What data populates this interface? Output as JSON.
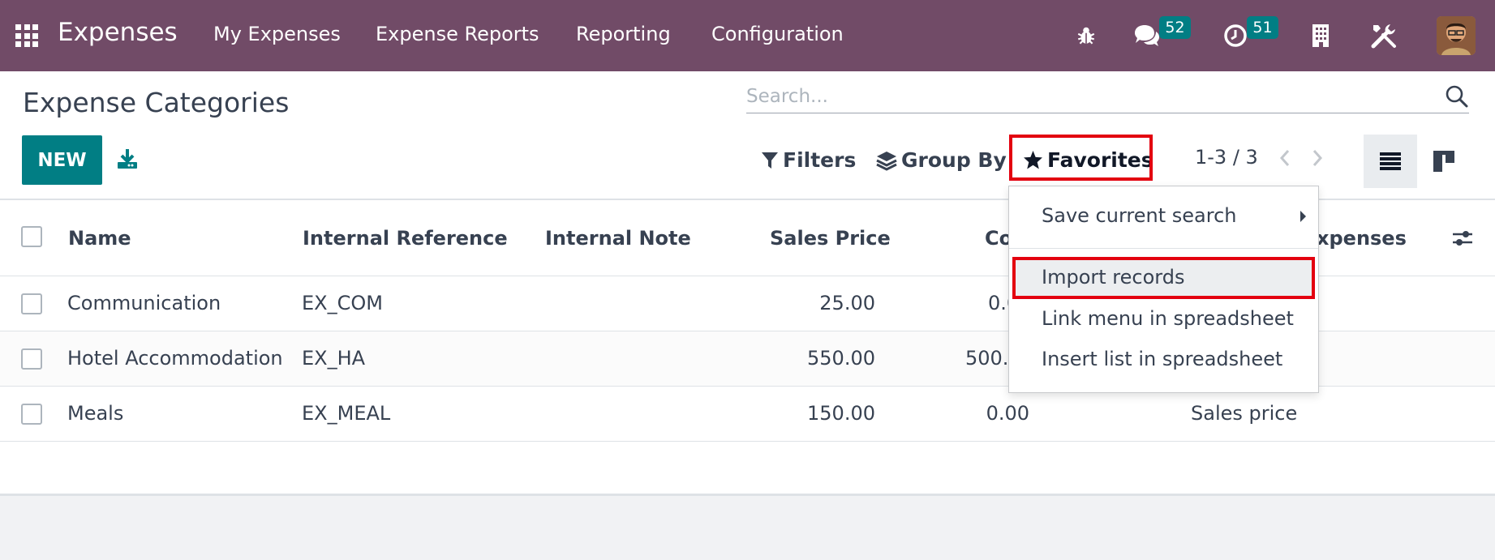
{
  "navbar": {
    "app_title": "Expenses",
    "menu": [
      "My Expenses",
      "Expense Reports",
      "Reporting",
      "Configuration"
    ],
    "messages_count": "52",
    "activities_count": "51",
    "bg_color": "#714b67",
    "badge_color": "#017e84"
  },
  "panel": {
    "title": "Expense Categories",
    "search_placeholder": "Search...",
    "new_label": "NEW",
    "filters_label": "Filters",
    "groupby_label": "Group By",
    "favorites_label": "Favorites",
    "pager": "1-3 / 3"
  },
  "table": {
    "headers": [
      "Name",
      "Internal Reference",
      "Internal Note",
      "Sales Price",
      "Co",
      "xpenses"
    ],
    "rows": [
      {
        "name": "Communication",
        "ref": "EX_COM",
        "note": "",
        "price": "25.00",
        "cost": "0.0",
        "policy": ""
      },
      {
        "name": "Hotel Accommodation",
        "ref": "EX_HA",
        "note": "",
        "price": "550.00",
        "cost": "500.0",
        "policy": ""
      },
      {
        "name": "Meals",
        "ref": "EX_MEAL",
        "note": "",
        "price": "150.00",
        "cost": "0.00",
        "policy": "Sales price"
      }
    ]
  },
  "favorites_menu": {
    "save_search": "Save current search",
    "import_records": "Import records",
    "link_menu": "Link menu in spreadsheet",
    "insert_list": "Insert list in spreadsheet"
  },
  "icons": [
    "apps-icon",
    "bug-icon",
    "chat-icon",
    "clock-icon",
    "building-icon",
    "tools-icon",
    "search-icon",
    "download-icon",
    "filter-icon",
    "layers-icon",
    "star-icon",
    "list-view-icon",
    "kanban-view-icon",
    "optional-columns-icon"
  ],
  "accent_color": "#017e84",
  "highlight_color": "#e3000f"
}
